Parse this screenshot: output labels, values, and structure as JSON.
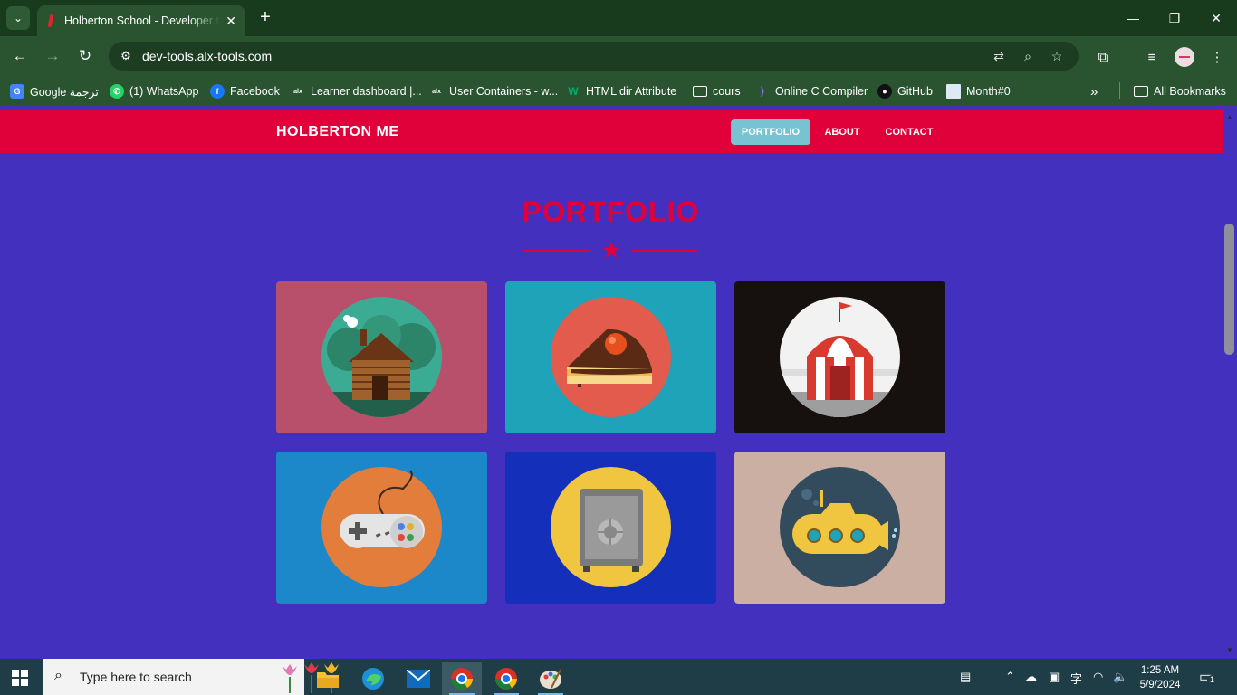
{
  "browser": {
    "tab_title": "Holberton School - Developer tools",
    "url": "dev-tools.alx-tools.com",
    "bookmarks": [
      {
        "label": "Google ترجمة",
        "icon": "google-translate-icon",
        "color": "#4285f4"
      },
      {
        "label": "(1) WhatsApp",
        "icon": "whatsapp-icon",
        "color": "#25d366"
      },
      {
        "label": "Facebook",
        "icon": "facebook-icon",
        "color": "#1877f2"
      },
      {
        "label": "Learner dashboard |...",
        "icon": "alx-icon",
        "color": "#1f2e2e"
      },
      {
        "label": "User Containers - w...",
        "icon": "alx-icon",
        "color": "#1f2e2e"
      },
      {
        "label": "HTML dir Attribute",
        "icon": "w3schools-icon",
        "color": "#04aa6d"
      },
      {
        "label": "cours",
        "icon": "folder-icon",
        "color": "#2a5430"
      },
      {
        "label": "Online C Compiler",
        "icon": "onlinegdb-icon",
        "color": "#6a3de8"
      },
      {
        "label": "GitHub",
        "icon": "github-icon",
        "color": "#111111"
      },
      {
        "label": "Month#0",
        "icon": "document-icon",
        "color": "#dfe8f5"
      }
    ],
    "all_bookmarks": "All Bookmarks"
  },
  "site": {
    "brand": "HOLBERTON ME",
    "nav": [
      {
        "label": "PORTFOLIO",
        "active": true
      },
      {
        "label": "ABOUT",
        "active": false
      },
      {
        "label": "CONTACT",
        "active": false
      }
    ],
    "section_title": "PORTFOLIO",
    "colors": {
      "nav_bg": "#e0003a",
      "page_bg": "#4330be",
      "accent": "#e0003a",
      "active_link": "#78c3d2"
    },
    "portfolio": [
      {
        "subject": "log-cabin",
        "bg": "#b9506b",
        "circle": "#3bab94"
      },
      {
        "subject": "cake",
        "bg": "#1fa3b8",
        "circle": "#e25b4d"
      },
      {
        "subject": "circus-tent",
        "bg": "#16110f",
        "circle": "#f2f2f2"
      },
      {
        "subject": "game-controller",
        "bg": "#1c87c9",
        "circle": "#e27d3c"
      },
      {
        "subject": "safe",
        "bg": "#1430bb",
        "circle": "#f0c540"
      },
      {
        "subject": "submarine",
        "bg": "#cbafa2",
        "circle": "#334c5d"
      }
    ]
  },
  "taskbar": {
    "search_placeholder": "Type here to search",
    "time": "1:25 AM",
    "date": "5/9/2024",
    "notifications": "1"
  }
}
